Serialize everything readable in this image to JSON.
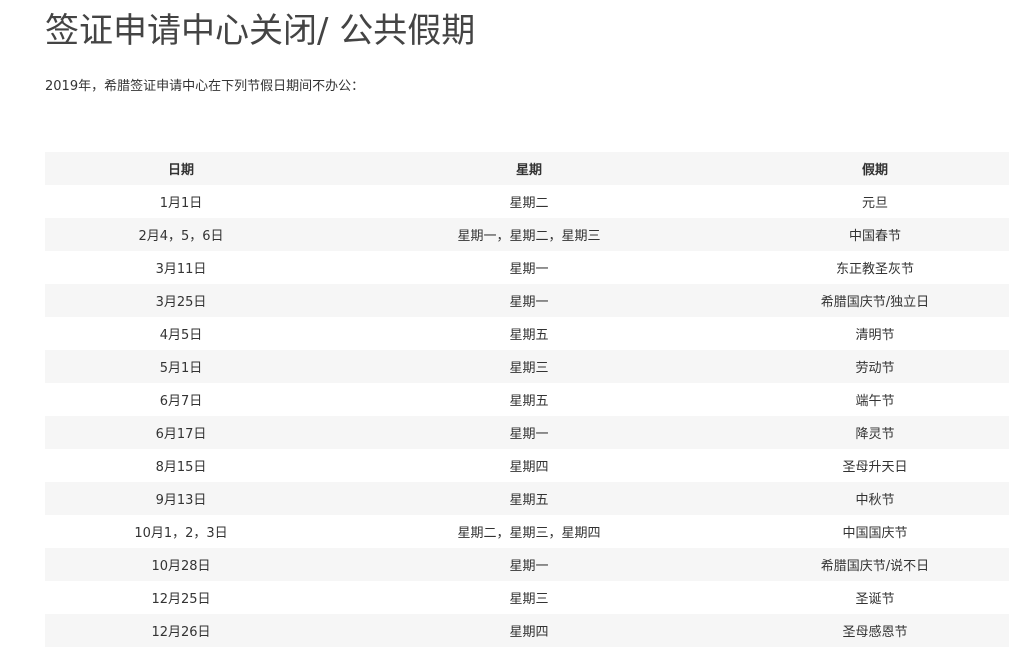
{
  "title": "签证申请中心关闭/ 公共假期",
  "intro": "2019年，希腊签证申请中心在下列节假日期间不办公：",
  "table": {
    "headers": [
      "日期",
      "星期",
      "假期"
    ],
    "rows": [
      [
        "1月1日",
        "星期二",
        "元旦"
      ],
      [
        "2月4，5，6日",
        "星期一，星期二，星期三",
        "中国春节"
      ],
      [
        "3月11日",
        "星期一",
        "东正教圣灰节"
      ],
      [
        "3月25日",
        "星期一",
        "希腊国庆节/独立日"
      ],
      [
        "4月5日",
        "星期五",
        "清明节"
      ],
      [
        "5月1日",
        "星期三",
        "劳动节"
      ],
      [
        "6月7日",
        "星期五",
        "端午节"
      ],
      [
        "6月17日",
        "星期一",
        "降灵节"
      ],
      [
        "8月15日",
        "星期四",
        "圣母升天日"
      ],
      [
        "9月13日",
        "星期五",
        "中秋节"
      ],
      [
        "10月1，2，3日",
        "星期二，星期三，星期四",
        "中国国庆节"
      ],
      [
        "10月28日",
        "星期一",
        "希腊国庆节/说不日"
      ],
      [
        "12月25日",
        "星期三",
        "圣诞节"
      ],
      [
        "12月26日",
        "星期四",
        "圣母感恩节"
      ]
    ]
  }
}
